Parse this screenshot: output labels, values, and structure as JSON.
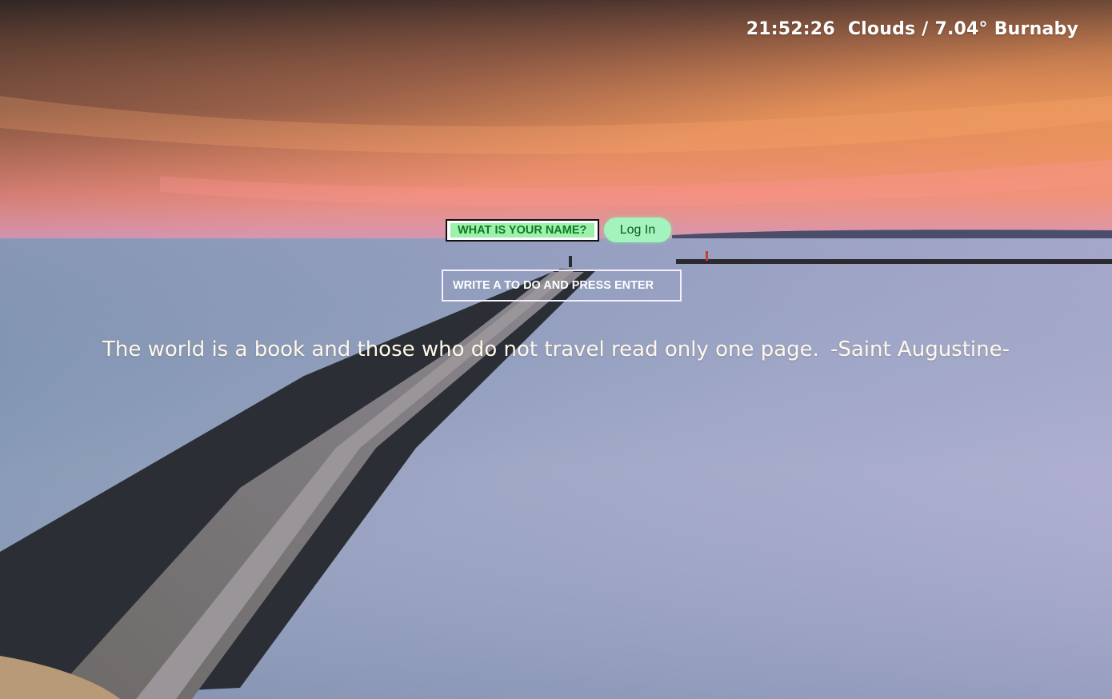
{
  "header": {
    "clock": "21:52:26",
    "weather_condition": "Clouds /",
    "temperature": "7.04°",
    "city": "Burnaby"
  },
  "login": {
    "name_placeholder": "WHAT IS YOUR NAME?",
    "login_label": "Log In"
  },
  "todo": {
    "placeholder": "WRITE A TO DO AND PRESS ENTER"
  },
  "quote": {
    "text": "The world is a book and those who do not travel read only one page.",
    "author": "-Saint Augustine-"
  },
  "background": {
    "description_icon": "seaside-pier-sunset-image",
    "sky_top": "#4a3a34",
    "sky_orange": "#e88d3f",
    "sky_pink": "#f29188",
    "water_top": "#b9b6d2",
    "water_bottom": "#6b8fa6"
  }
}
